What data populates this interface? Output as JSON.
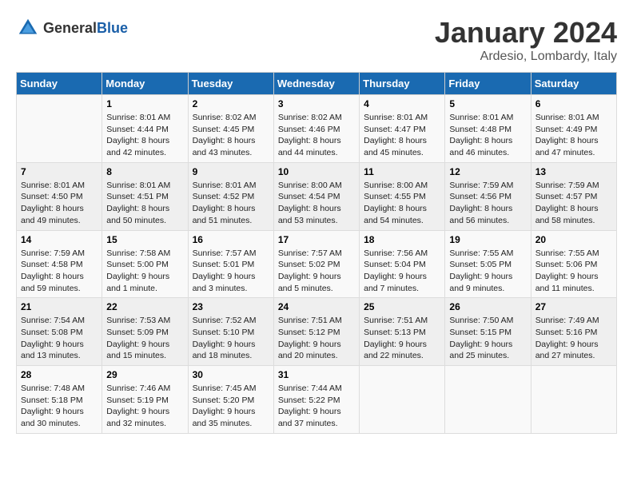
{
  "header": {
    "logo_general": "General",
    "logo_blue": "Blue",
    "title": "January 2024",
    "subtitle": "Ardesio, Lombardy, Italy"
  },
  "calendar": {
    "days_of_week": [
      "Sunday",
      "Monday",
      "Tuesday",
      "Wednesday",
      "Thursday",
      "Friday",
      "Saturday"
    ],
    "weeks": [
      [
        {
          "day": "",
          "sunrise": "",
          "sunset": "",
          "daylight": ""
        },
        {
          "day": "1",
          "sunrise": "Sunrise: 8:01 AM",
          "sunset": "Sunset: 4:44 PM",
          "daylight": "Daylight: 8 hours and 42 minutes."
        },
        {
          "day": "2",
          "sunrise": "Sunrise: 8:02 AM",
          "sunset": "Sunset: 4:45 PM",
          "daylight": "Daylight: 8 hours and 43 minutes."
        },
        {
          "day": "3",
          "sunrise": "Sunrise: 8:02 AM",
          "sunset": "Sunset: 4:46 PM",
          "daylight": "Daylight: 8 hours and 44 minutes."
        },
        {
          "day": "4",
          "sunrise": "Sunrise: 8:01 AM",
          "sunset": "Sunset: 4:47 PM",
          "daylight": "Daylight: 8 hours and 45 minutes."
        },
        {
          "day": "5",
          "sunrise": "Sunrise: 8:01 AM",
          "sunset": "Sunset: 4:48 PM",
          "daylight": "Daylight: 8 hours and 46 minutes."
        },
        {
          "day": "6",
          "sunrise": "Sunrise: 8:01 AM",
          "sunset": "Sunset: 4:49 PM",
          "daylight": "Daylight: 8 hours and 47 minutes."
        }
      ],
      [
        {
          "day": "7",
          "sunrise": "Sunrise: 8:01 AM",
          "sunset": "Sunset: 4:50 PM",
          "daylight": "Daylight: 8 hours and 49 minutes."
        },
        {
          "day": "8",
          "sunrise": "Sunrise: 8:01 AM",
          "sunset": "Sunset: 4:51 PM",
          "daylight": "Daylight: 8 hours and 50 minutes."
        },
        {
          "day": "9",
          "sunrise": "Sunrise: 8:01 AM",
          "sunset": "Sunset: 4:52 PM",
          "daylight": "Daylight: 8 hours and 51 minutes."
        },
        {
          "day": "10",
          "sunrise": "Sunrise: 8:00 AM",
          "sunset": "Sunset: 4:54 PM",
          "daylight": "Daylight: 8 hours and 53 minutes."
        },
        {
          "day": "11",
          "sunrise": "Sunrise: 8:00 AM",
          "sunset": "Sunset: 4:55 PM",
          "daylight": "Daylight: 8 hours and 54 minutes."
        },
        {
          "day": "12",
          "sunrise": "Sunrise: 7:59 AM",
          "sunset": "Sunset: 4:56 PM",
          "daylight": "Daylight: 8 hours and 56 minutes."
        },
        {
          "day": "13",
          "sunrise": "Sunrise: 7:59 AM",
          "sunset": "Sunset: 4:57 PM",
          "daylight": "Daylight: 8 hours and 58 minutes."
        }
      ],
      [
        {
          "day": "14",
          "sunrise": "Sunrise: 7:59 AM",
          "sunset": "Sunset: 4:58 PM",
          "daylight": "Daylight: 8 hours and 59 minutes."
        },
        {
          "day": "15",
          "sunrise": "Sunrise: 7:58 AM",
          "sunset": "Sunset: 5:00 PM",
          "daylight": "Daylight: 9 hours and 1 minute."
        },
        {
          "day": "16",
          "sunrise": "Sunrise: 7:57 AM",
          "sunset": "Sunset: 5:01 PM",
          "daylight": "Daylight: 9 hours and 3 minutes."
        },
        {
          "day": "17",
          "sunrise": "Sunrise: 7:57 AM",
          "sunset": "Sunset: 5:02 PM",
          "daylight": "Daylight: 9 hours and 5 minutes."
        },
        {
          "day": "18",
          "sunrise": "Sunrise: 7:56 AM",
          "sunset": "Sunset: 5:04 PM",
          "daylight": "Daylight: 9 hours and 7 minutes."
        },
        {
          "day": "19",
          "sunrise": "Sunrise: 7:55 AM",
          "sunset": "Sunset: 5:05 PM",
          "daylight": "Daylight: 9 hours and 9 minutes."
        },
        {
          "day": "20",
          "sunrise": "Sunrise: 7:55 AM",
          "sunset": "Sunset: 5:06 PM",
          "daylight": "Daylight: 9 hours and 11 minutes."
        }
      ],
      [
        {
          "day": "21",
          "sunrise": "Sunrise: 7:54 AM",
          "sunset": "Sunset: 5:08 PM",
          "daylight": "Daylight: 9 hours and 13 minutes."
        },
        {
          "day": "22",
          "sunrise": "Sunrise: 7:53 AM",
          "sunset": "Sunset: 5:09 PM",
          "daylight": "Daylight: 9 hours and 15 minutes."
        },
        {
          "day": "23",
          "sunrise": "Sunrise: 7:52 AM",
          "sunset": "Sunset: 5:10 PM",
          "daylight": "Daylight: 9 hours and 18 minutes."
        },
        {
          "day": "24",
          "sunrise": "Sunrise: 7:51 AM",
          "sunset": "Sunset: 5:12 PM",
          "daylight": "Daylight: 9 hours and 20 minutes."
        },
        {
          "day": "25",
          "sunrise": "Sunrise: 7:51 AM",
          "sunset": "Sunset: 5:13 PM",
          "daylight": "Daylight: 9 hours and 22 minutes."
        },
        {
          "day": "26",
          "sunrise": "Sunrise: 7:50 AM",
          "sunset": "Sunset: 5:15 PM",
          "daylight": "Daylight: 9 hours and 25 minutes."
        },
        {
          "day": "27",
          "sunrise": "Sunrise: 7:49 AM",
          "sunset": "Sunset: 5:16 PM",
          "daylight": "Daylight: 9 hours and 27 minutes."
        }
      ],
      [
        {
          "day": "28",
          "sunrise": "Sunrise: 7:48 AM",
          "sunset": "Sunset: 5:18 PM",
          "daylight": "Daylight: 9 hours and 30 minutes."
        },
        {
          "day": "29",
          "sunrise": "Sunrise: 7:46 AM",
          "sunset": "Sunset: 5:19 PM",
          "daylight": "Daylight: 9 hours and 32 minutes."
        },
        {
          "day": "30",
          "sunrise": "Sunrise: 7:45 AM",
          "sunset": "Sunset: 5:20 PM",
          "daylight": "Daylight: 9 hours and 35 minutes."
        },
        {
          "day": "31",
          "sunrise": "Sunrise: 7:44 AM",
          "sunset": "Sunset: 5:22 PM",
          "daylight": "Daylight: 9 hours and 37 minutes."
        },
        {
          "day": "",
          "sunrise": "",
          "sunset": "",
          "daylight": ""
        },
        {
          "day": "",
          "sunrise": "",
          "sunset": "",
          "daylight": ""
        },
        {
          "day": "",
          "sunrise": "",
          "sunset": "",
          "daylight": ""
        }
      ]
    ]
  }
}
